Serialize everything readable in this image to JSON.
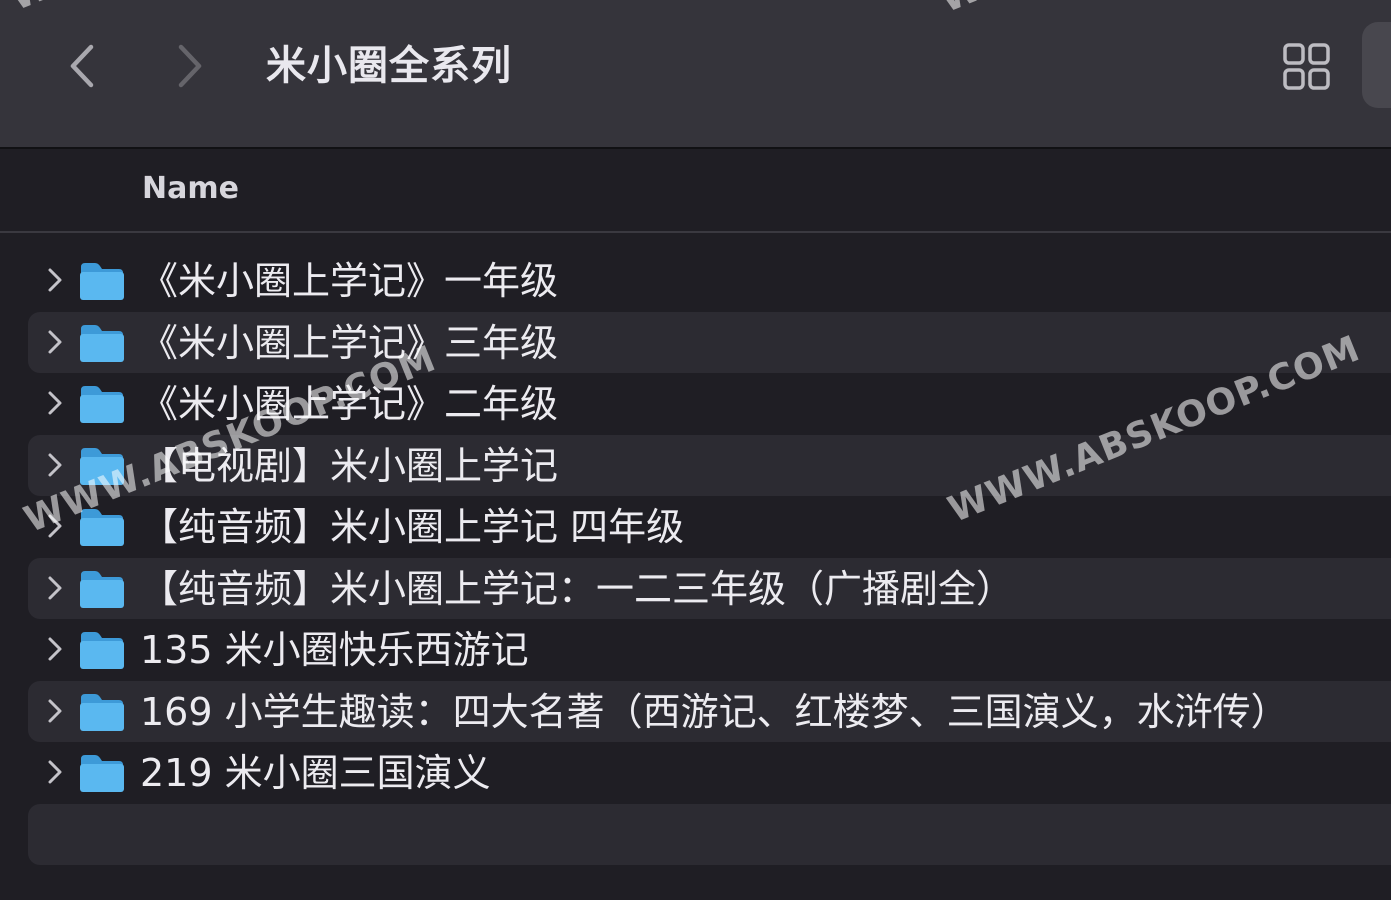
{
  "toolbar": {
    "title": "米小圈全系列",
    "back_icon": "chevron-left-icon",
    "forward_icon": "chevron-right-icon",
    "view_icon": "grid-view-icon"
  },
  "columns": {
    "name": "Name"
  },
  "items": [
    {
      "label": "《米小圈上学记》一年级",
      "icon": "folder-icon"
    },
    {
      "label": "《米小圈上学记》三年级",
      "icon": "folder-icon"
    },
    {
      "label": "《米小圈上学记》二年级",
      "icon": "folder-icon"
    },
    {
      "label": "【电视剧】米小圈上学记",
      "icon": "folder-icon"
    },
    {
      "label": "【纯音频】米小圈上学记 四年级",
      "icon": "folder-icon"
    },
    {
      "label": "【纯音频】米小圈上学记：一二三年级（广播剧全）",
      "icon": "folder-icon"
    },
    {
      "label": "135 米小圈快乐西游记",
      "icon": "folder-icon"
    },
    {
      "label": "169 小学生趣读：四大名著（西游记、红楼梦、三国演义，水浒传）",
      "icon": "folder-icon"
    },
    {
      "label": "219 米小圈三国演义",
      "icon": "folder-icon"
    }
  ],
  "watermark": {
    "text": "WWW.ABSKOOP.COM"
  },
  "colors": {
    "toolbar_bg": "#35343b",
    "list_bg": "#1f1e24",
    "alt_row_bg": "#2c2b32",
    "folder_blue": "#5ab8f0"
  }
}
